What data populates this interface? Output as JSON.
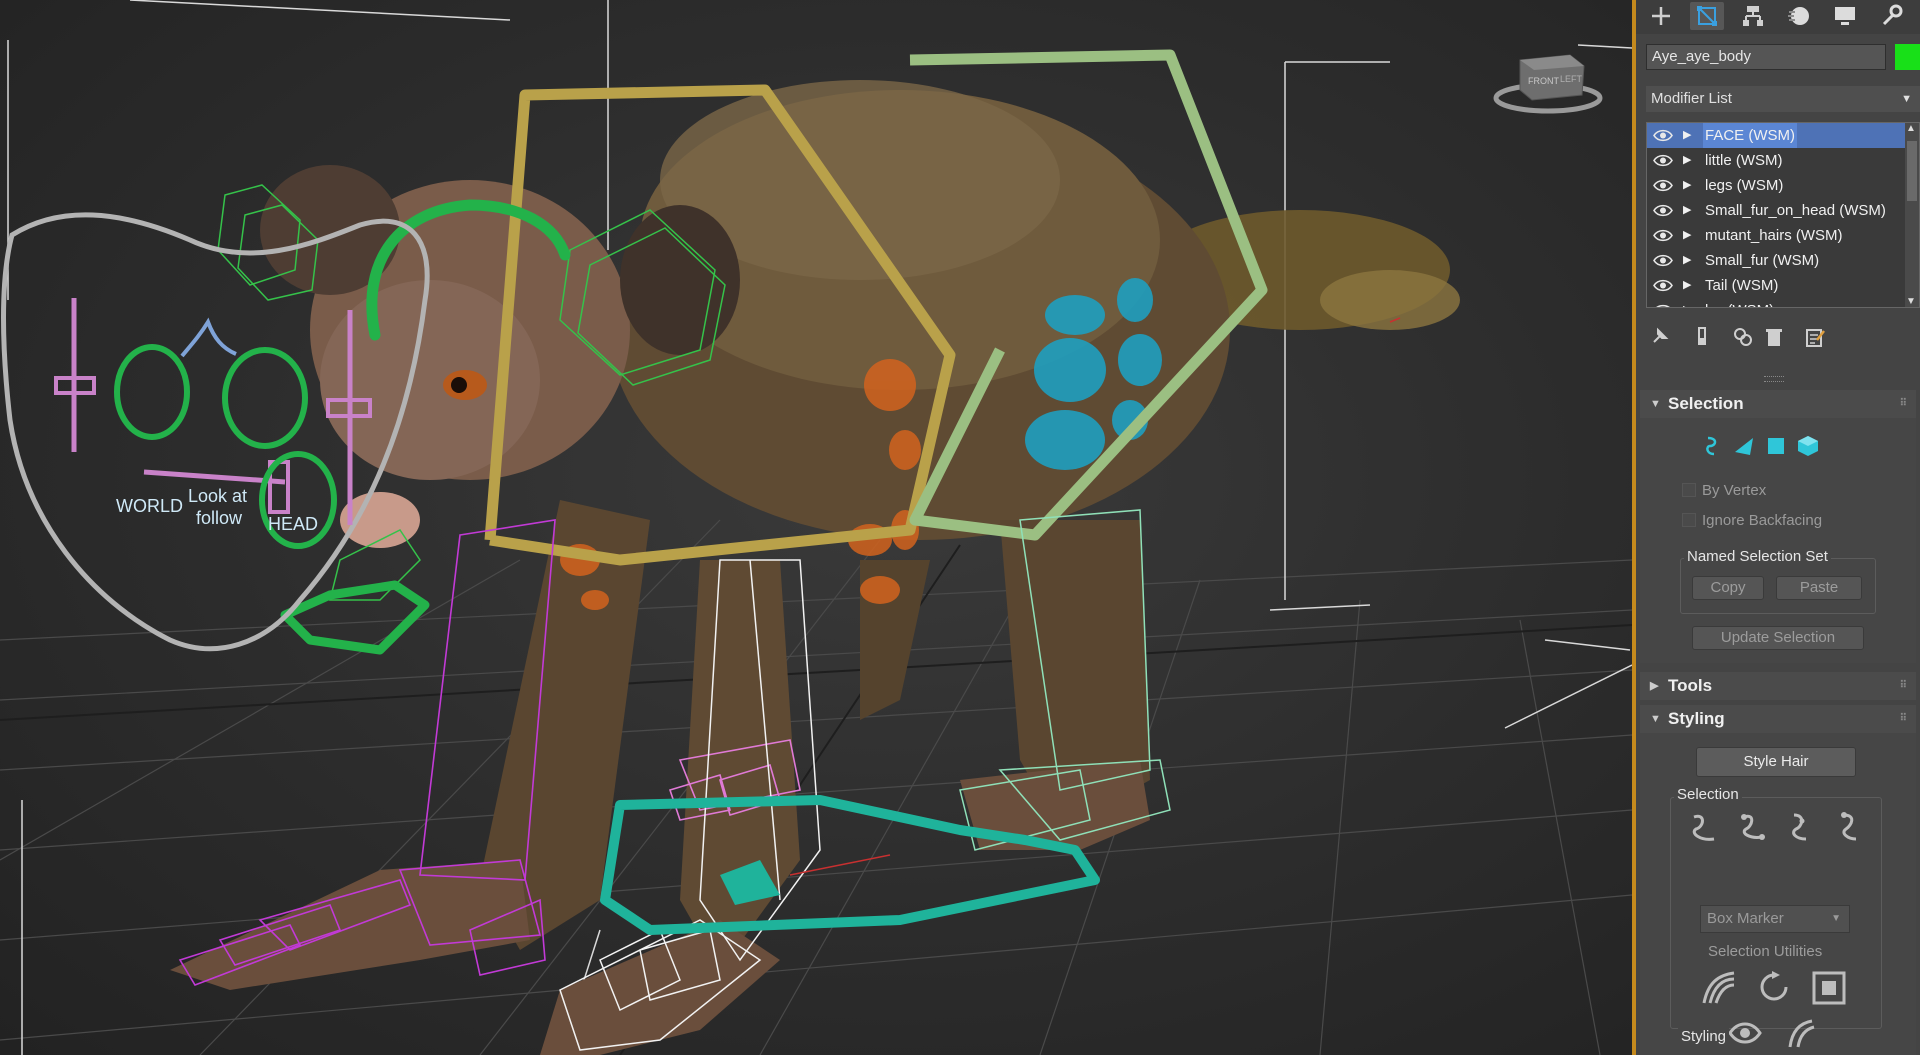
{
  "viewport": {
    "rig_labels": {
      "world": "WORLD",
      "look_at": "Look at",
      "follow": "follow",
      "head": "HEAD"
    },
    "viewcube_faces": {
      "front": "FRONT",
      "left": "LEFT"
    }
  },
  "command_panel": {
    "tabs": [
      {
        "name": "create",
        "icon": "plus-icon"
      },
      {
        "name": "modify",
        "icon": "modify-icon",
        "active": true
      },
      {
        "name": "hierarchy",
        "icon": "hierarchy-icon"
      },
      {
        "name": "motion",
        "icon": "motion-icon"
      },
      {
        "name": "display",
        "icon": "display-icon"
      },
      {
        "name": "utilities",
        "icon": "wrench-icon"
      }
    ],
    "object_name": "Aye_aye_body",
    "object_color": "#18e018",
    "modifier_list_label": "Modifier List",
    "stack": [
      {
        "label": "FACE (WSM)",
        "selected": true
      },
      {
        "label": "little (WSM)"
      },
      {
        "label": "legs (WSM)"
      },
      {
        "label": "Small_fur_on_head (WSM)"
      },
      {
        "label": "mutant_hairs (WSM)"
      },
      {
        "label": "Small_fur (WSM)"
      },
      {
        "label": "Tail (WSM)"
      },
      {
        "label": "l… (WSM)"
      }
    ],
    "stack_tools": [
      "pin-stack-icon",
      "show-end-result-icon",
      "make-unique-icon",
      "remove-modifier-icon",
      "configure-modifier-sets-icon"
    ],
    "selection": {
      "title": "Selection",
      "by_vertex": "By Vertex",
      "ignore_backfacing": "Ignore Backfacing",
      "named_selection_set": "Named Selection Set",
      "copy": "Copy",
      "paste": "Paste",
      "update_selection": "Update Selection"
    },
    "tools": {
      "title": "Tools"
    },
    "styling": {
      "title": "Styling",
      "style_hair": "Style Hair",
      "selection_group": "Selection",
      "marker": "Box Marker",
      "selection_utilities": "Selection Utilities",
      "styling_group": "Styling"
    }
  }
}
